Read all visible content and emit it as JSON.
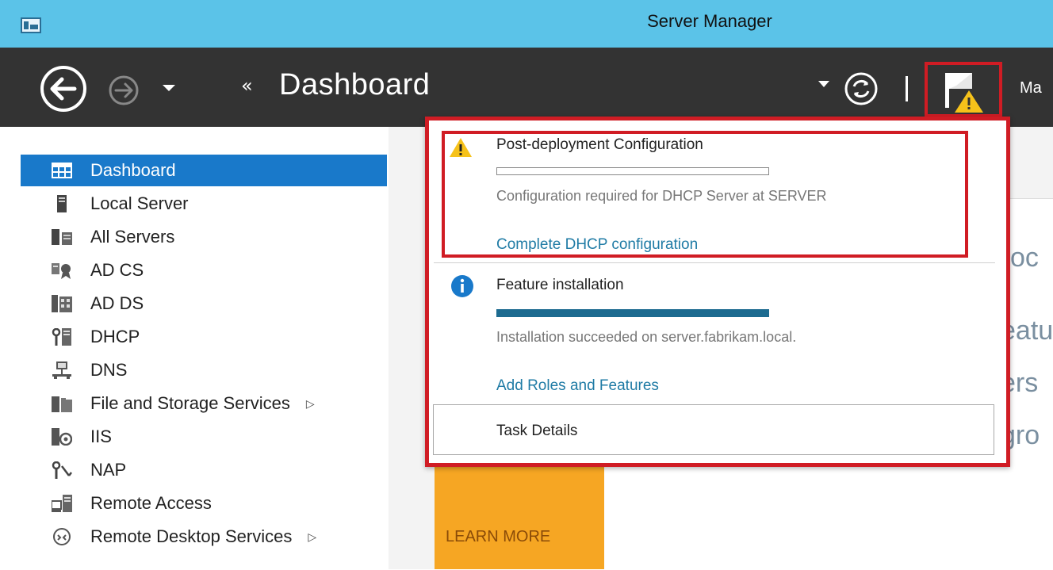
{
  "window": {
    "title": "Server Manager"
  },
  "header": {
    "breadcrumb_arrows": "«",
    "page_title": "Dashboard",
    "manage_partial": "Ma"
  },
  "sidebar": {
    "items": [
      {
        "label": "Dashboard",
        "icon": "dashboard-icon",
        "active": true
      },
      {
        "label": "Local Server",
        "icon": "local-server-icon"
      },
      {
        "label": "All Servers",
        "icon": "all-servers-icon"
      },
      {
        "label": "AD CS",
        "icon": "ad-cs-icon"
      },
      {
        "label": "AD DS",
        "icon": "ad-ds-icon"
      },
      {
        "label": "DHCP",
        "icon": "dhcp-icon"
      },
      {
        "label": "DNS",
        "icon": "dns-icon"
      },
      {
        "label": "File and Storage Services",
        "icon": "file-storage-icon",
        "expand": "▷"
      },
      {
        "label": "IIS",
        "icon": "iis-icon"
      },
      {
        "label": "NAP",
        "icon": "nap-icon"
      },
      {
        "label": "Remote Access",
        "icon": "remote-access-icon"
      },
      {
        "label": "Remote Desktop Services",
        "icon": "remote-desktop-icon",
        "expand": "▷"
      }
    ]
  },
  "notifications": {
    "items": [
      {
        "title": "Post-deployment Configuration",
        "icon": "warning-icon",
        "progress": 0,
        "message": "Configuration required for DHCP Server at SERVER",
        "link": "Complete DHCP configuration"
      },
      {
        "title": "Feature installation",
        "icon": "info-icon",
        "progress": 1.0,
        "message": "Installation succeeded on server.fabrikam.local.",
        "link": "Add Roles and Features"
      }
    ],
    "task_details": "Task Details"
  },
  "background": {
    "fragments": [
      "oc",
      "eatu",
      "ers",
      "gro"
    ],
    "learn_more": "LEARN MORE"
  },
  "colors": {
    "title_bar": "#5bc3e8",
    "header": "#333333",
    "active_nav": "#1979ca",
    "highlight_border": "#d01c24",
    "link": "#1f7ba5",
    "progress_fill": "#1d6b90",
    "learn_tile": "#f6a623"
  }
}
